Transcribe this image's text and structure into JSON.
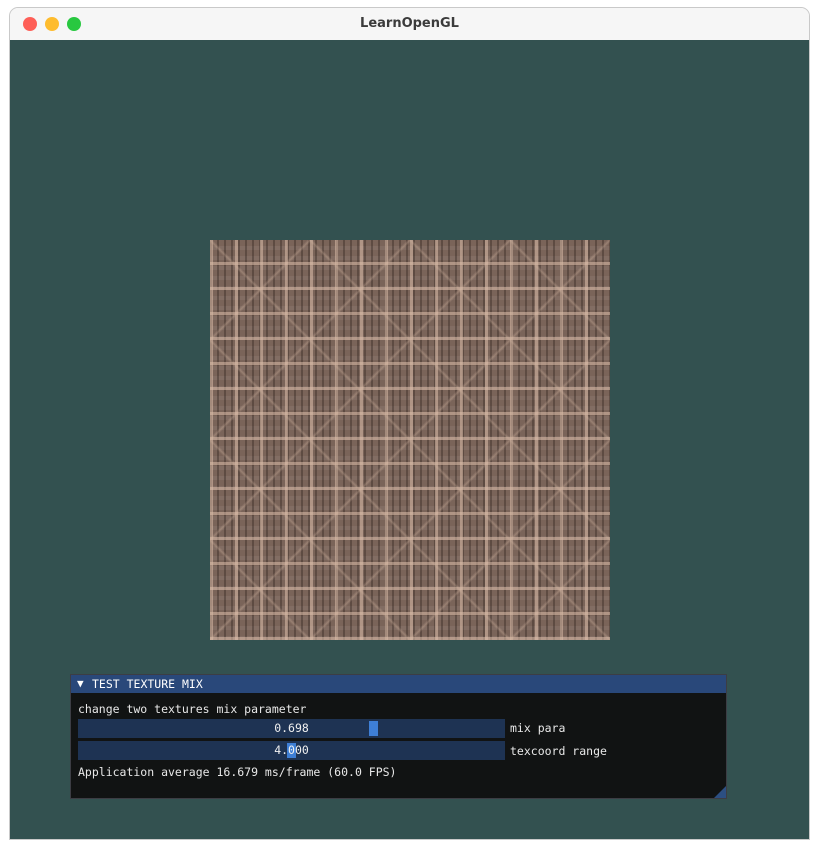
{
  "window": {
    "title": "LearnOpenGL",
    "traffic_colors": {
      "close": "#fe5f57",
      "minimize": "#febc2e",
      "maximize": "#28c840"
    }
  },
  "viewport": {
    "clear_color": "#335150"
  },
  "imgui": {
    "title": "TEST TEXTURE MIX",
    "collapse_icon": "▼",
    "description": "change two textures mix parameter",
    "sliders": [
      {
        "value": "0.698",
        "label": "mix para",
        "fraction": 0.698
      },
      {
        "value": "4.000",
        "label": "texcoord range",
        "fraction": 0.5
      }
    ],
    "stats": "Application average 16.679 ms/frame (60.0 FPS)"
  }
}
